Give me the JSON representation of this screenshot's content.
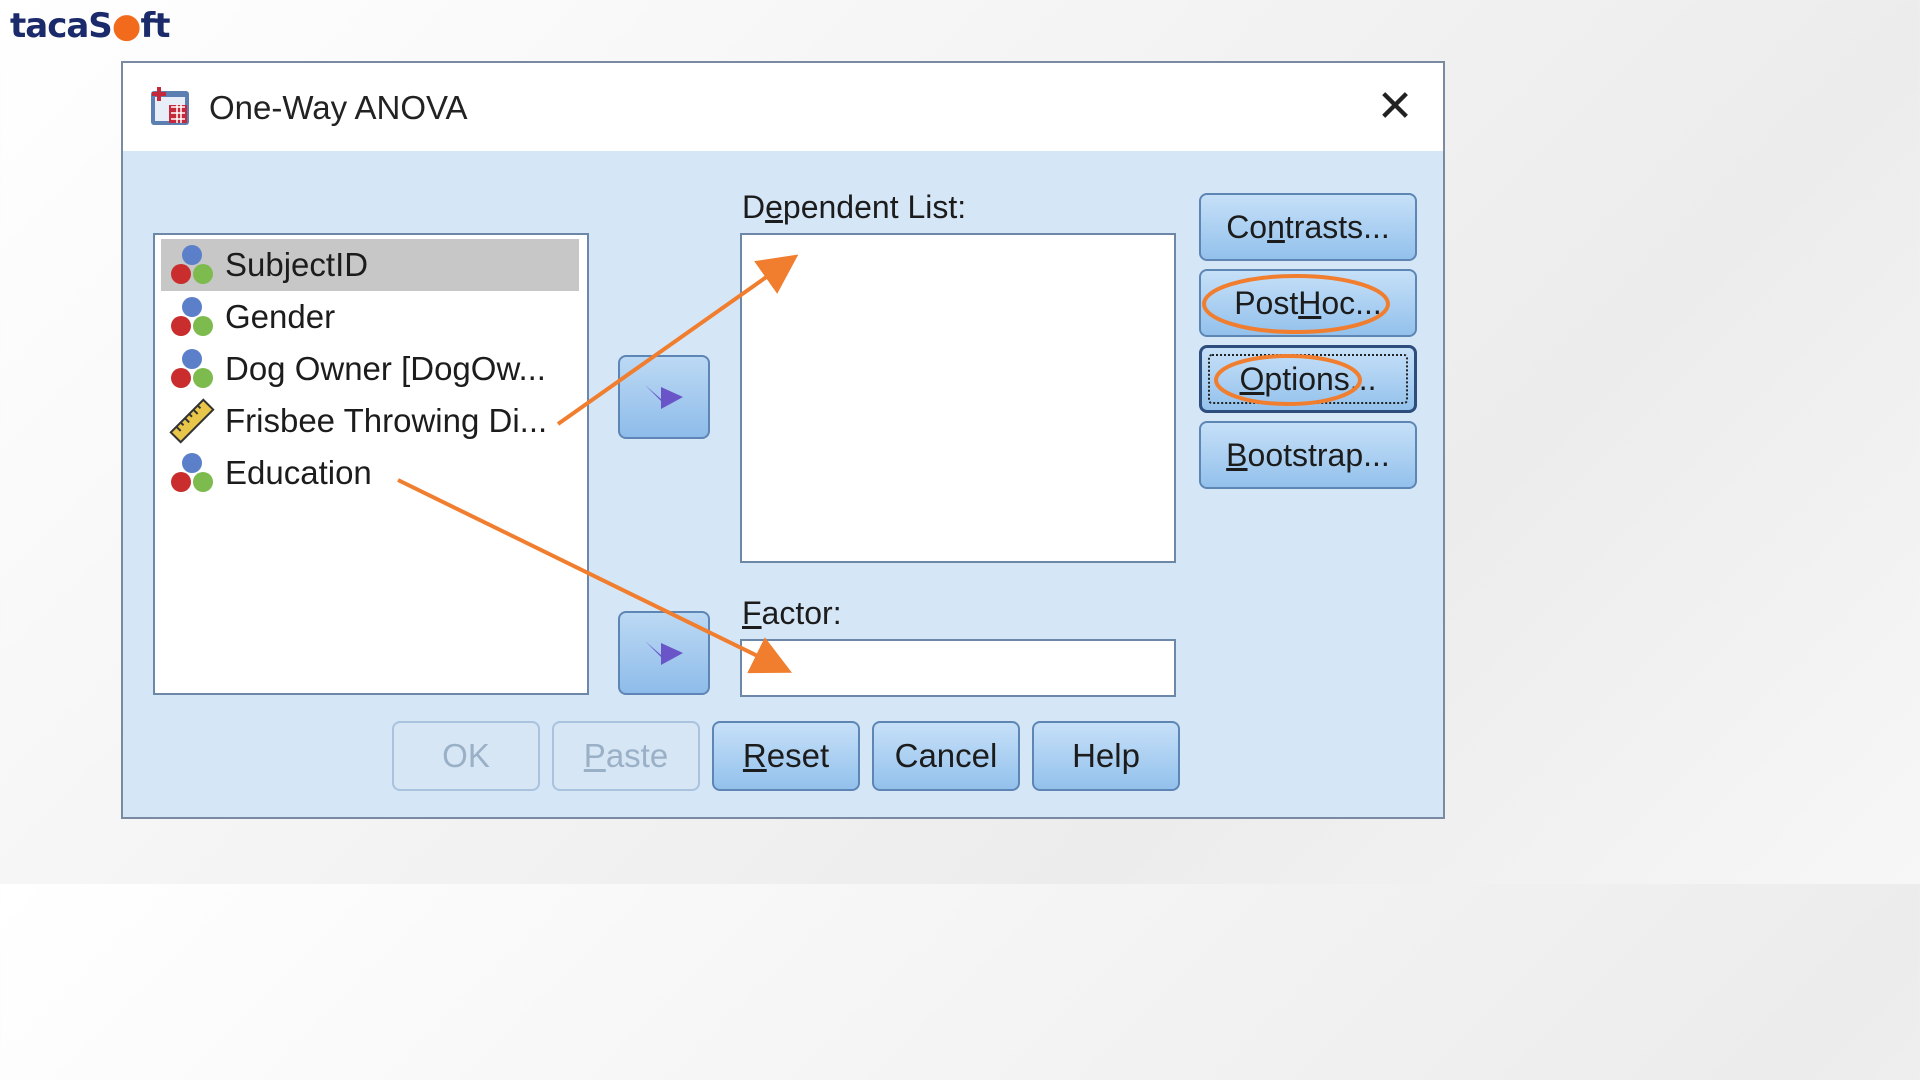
{
  "brand": {
    "part1": "taca",
    "part2": "S",
    "part3": "ft",
    "accent": "#f26b1d"
  },
  "window": {
    "title": "One-Way ANOVA",
    "close_glyph": "✕"
  },
  "variables": [
    {
      "label": "SubjectID",
      "icon": "nominal-variable-icon",
      "selected": true
    },
    {
      "label": "Gender",
      "icon": "nominal-variable-icon",
      "selected": false
    },
    {
      "label": "Dog Owner [DogOw...",
      "icon": "nominal-variable-icon",
      "selected": false
    },
    {
      "label": "Frisbee Throwing Di...",
      "icon": "scale-variable-icon",
      "selected": false
    },
    {
      "label": "Education",
      "icon": "nominal-variable-icon",
      "selected": false
    }
  ],
  "dependent_list": {
    "label_pre": "D",
    "label_u": "e",
    "label_post": "pendent List:"
  },
  "factor": {
    "label_u": "F",
    "label_post": "actor:"
  },
  "side_buttons": {
    "contrasts": {
      "pre": "Co",
      "u": "n",
      "post": "trasts..."
    },
    "post_hoc": {
      "pre": "Post ",
      "u": "H",
      "post": "oc..."
    },
    "options": {
      "pre": "",
      "u": "O",
      "post": "ptions..."
    },
    "bootstrap": {
      "pre": "",
      "u": "B",
      "post": "ootstrap..."
    }
  },
  "bottom_buttons": {
    "ok": "OK",
    "paste": {
      "u": "P",
      "post": "aste"
    },
    "reset": {
      "u": "R",
      "post": "eset"
    },
    "cancel": "Cancel",
    "help": "Help"
  },
  "colors": {
    "annotation": "#f07e2e",
    "dialog_bg": "#d5e6f7",
    "button_blue": "#93c1ec"
  }
}
